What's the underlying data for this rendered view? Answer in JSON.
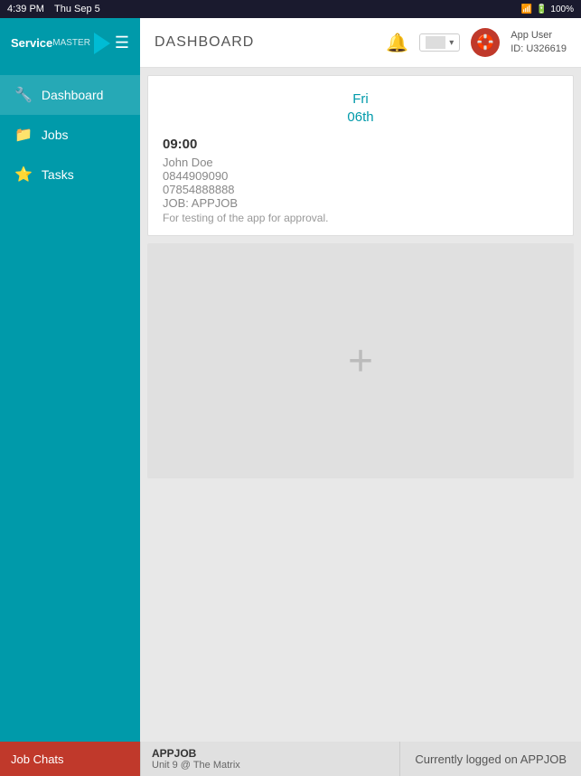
{
  "statusBar": {
    "time": "4:39 PM",
    "date": "Thu Sep 5",
    "signal": "WiFi",
    "battery": "100%"
  },
  "sidebar": {
    "logo": "ServiceMASTER",
    "items": [
      {
        "label": "Dashboard",
        "icon": "🔧",
        "active": true
      },
      {
        "label": "Jobs",
        "icon": "📁",
        "active": false
      },
      {
        "label": "Tasks",
        "icon": "⭐",
        "active": false
      }
    ]
  },
  "header": {
    "title": "DASHBOARD",
    "bell": "🔔",
    "user": {
      "name": "App User",
      "id": "ID: U326619",
      "avatar": "🛟"
    }
  },
  "calendar": {
    "date_line1": "Fri",
    "date_line2": "06th",
    "event": {
      "time": "09:00",
      "name": "John Doe",
      "phone1": "0844909090",
      "phone2": "07854888888",
      "job": "JOB: APPJOB",
      "description": "For testing of the app for approval."
    }
  },
  "plus_area": {
    "icon": "+"
  },
  "bottomBar": {
    "job_chats_label": "Job Chats",
    "job_id": "APPJOB",
    "job_location": "Unit 9 @ The Matrix",
    "logged_on": "Currently logged on APPJOB"
  }
}
